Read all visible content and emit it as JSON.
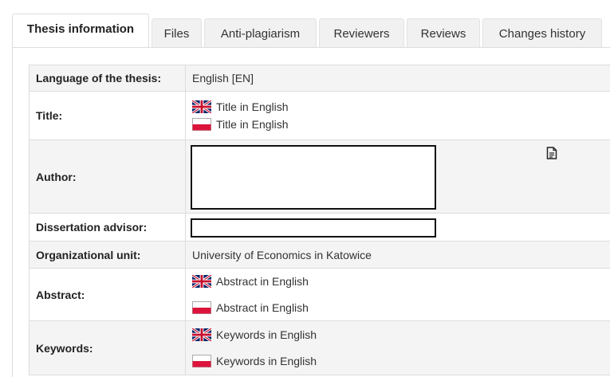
{
  "tabs": [
    {
      "label": "Thesis information",
      "active": true
    },
    {
      "label": "Files",
      "active": false
    },
    {
      "label": "Anti-plagiarism",
      "active": false
    },
    {
      "label": "Reviewers",
      "active": false
    },
    {
      "label": "Reviews",
      "active": false
    },
    {
      "label": "Changes history",
      "active": false
    }
  ],
  "rows": {
    "language": {
      "label": "Language of the thesis:",
      "value": "English [EN]"
    },
    "title": {
      "label": "Title:",
      "en": "Title in English",
      "pl": "Title in English"
    },
    "author": {
      "label": "Author:"
    },
    "advisor": {
      "label": "Dissertation advisor:"
    },
    "unit": {
      "label": "Organizational unit:",
      "value": "University of Economics in Katowice"
    },
    "abstract": {
      "label": "Abstract:",
      "en": "Abstract in English",
      "pl": "Abstract in English"
    },
    "keywords": {
      "label": "Keywords:",
      "en": "Keywords in English",
      "pl": "Keywords in English"
    }
  },
  "icons": {
    "uk_flag": "uk-flag-icon",
    "pl_flag": "poland-flag-icon",
    "author_details": "document-icon"
  },
  "colors": {
    "pl_red": "#dc143c",
    "uk_blue": "#012169",
    "uk_red": "#c8102e",
    "row_shade": "#f4f4f4",
    "border": "#dddddd"
  }
}
